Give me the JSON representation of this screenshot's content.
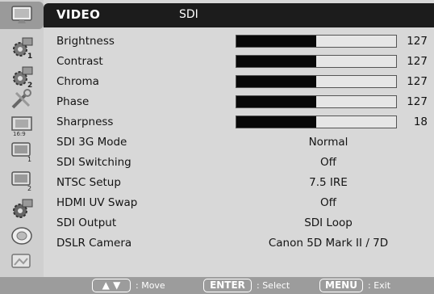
{
  "header": {
    "menu_title": "VIDEO",
    "input_source": "SDI"
  },
  "icons": [
    "monitor-icon",
    "gear-1-icon",
    "gear-2-icon",
    "tools-icon",
    "ratio-icon",
    "screen-1-icon",
    "screen-2-icon",
    "gear-3-icon",
    "disc-icon",
    "screen-3-icon"
  ],
  "rows": [
    {
      "label": "Brightness",
      "type": "bar",
      "value": "127",
      "level": 0.5
    },
    {
      "label": "Contrast",
      "type": "bar",
      "value": "127",
      "level": 0.5
    },
    {
      "label": "Chroma",
      "type": "bar",
      "value": "127",
      "level": 0.5
    },
    {
      "label": "Phase",
      "type": "bar",
      "value": "127",
      "level": 0.5
    },
    {
      "label": "Sharpness",
      "type": "bar",
      "value": "18",
      "level": 0.5
    },
    {
      "label": "SDI 3G Mode",
      "type": "text",
      "value": "Normal"
    },
    {
      "label": "SDI Switching",
      "type": "text",
      "value": "Off"
    },
    {
      "label": "NTSC Setup",
      "type": "text",
      "value": "7.5 IRE"
    },
    {
      "label": "HDMI UV Swap",
      "type": "text",
      "value": "Off"
    },
    {
      "label": "SDI Output",
      "type": "text",
      "value": "SDI Loop"
    },
    {
      "label": "DSLR Camera",
      "type": "text",
      "value": "Canon 5D Mark II / 7D"
    }
  ],
  "footer": {
    "move_key": "▲ ▼",
    "move_label": ": Move",
    "enter_key": "ENTER",
    "enter_label": ": Select",
    "menu_key": "MENU",
    "menu_label": ": Exit"
  }
}
